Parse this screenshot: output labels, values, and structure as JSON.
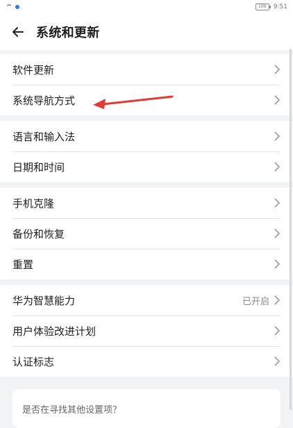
{
  "status": {
    "time": "9:51",
    "battery": "100"
  },
  "header": {
    "title": "系统和更新"
  },
  "groups": [
    {
      "items": [
        {
          "label": "软件更新"
        },
        {
          "label": "系统导航方式"
        }
      ]
    },
    {
      "items": [
        {
          "label": "语言和输入法"
        },
        {
          "label": "日期和时间"
        }
      ]
    },
    {
      "items": [
        {
          "label": "手机克隆"
        },
        {
          "label": "备份和恢复"
        },
        {
          "label": "重置"
        }
      ]
    },
    {
      "items": [
        {
          "label": "华为智慧能力",
          "value": "已开启"
        },
        {
          "label": "用户体验改进计划"
        },
        {
          "label": "认证标志"
        }
      ]
    }
  ],
  "search_card": {
    "text": "是否在寻找其他设置项？"
  },
  "colors": {
    "annotation_arrow": "#e53935",
    "accent": "#2a7de1"
  }
}
